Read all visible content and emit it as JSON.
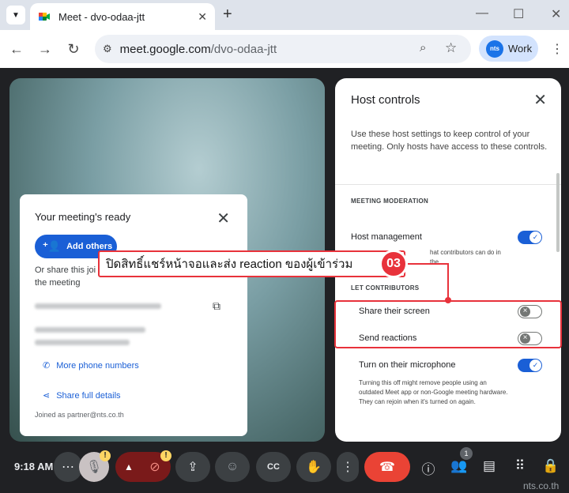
{
  "browser": {
    "tab_title": "Meet - dvo-odaa-jtt",
    "tab_close": "✕",
    "new_tab": "+",
    "url_host": "meet.google.com",
    "url_path": "/dvo-odaa-jtt",
    "profile_badge": "nts",
    "profile_label": "Work"
  },
  "ready_card": {
    "title": "Your meeting's ready",
    "add_others": "Add others",
    "share_text_1": "Or share this joi",
    "share_text_2": "the meeting",
    "more_phone": "More phone numbers",
    "share_details": "Share full details",
    "joined_as": "Joined as partner@nts.co.th"
  },
  "host_controls": {
    "title": "Host controls",
    "description": "Use these host settings to keep control of your meeting. Only hosts have access to these controls.",
    "section_moderation": "MEETING MODERATION",
    "host_management": "Host management",
    "host_management_desc_tail": "hat contributors can do in the",
    "section_let": "LET CONTRIBUTORS",
    "share_screen": "Share their screen",
    "send_reactions": "Send reactions",
    "microphone": "Turn on their microphone",
    "microphone_desc": "Turning this off might remove people using an outdated Meet app or non-Google meeting hardware. They can rejoin when it's turned on again.",
    "toggles": {
      "host_management": true,
      "share_screen": false,
      "send_reactions": false,
      "microphone": true
    }
  },
  "annotation": {
    "text": "ปิดสิทธิ์แชร์หน้าจอและส่ง reaction ของผู้เข้าร่วม",
    "number": "03",
    "color": "#e8323b"
  },
  "toolbar": {
    "time": "9:18 AM",
    "people_count": "1",
    "warn": "!"
  },
  "watermark": "nts.co.th"
}
